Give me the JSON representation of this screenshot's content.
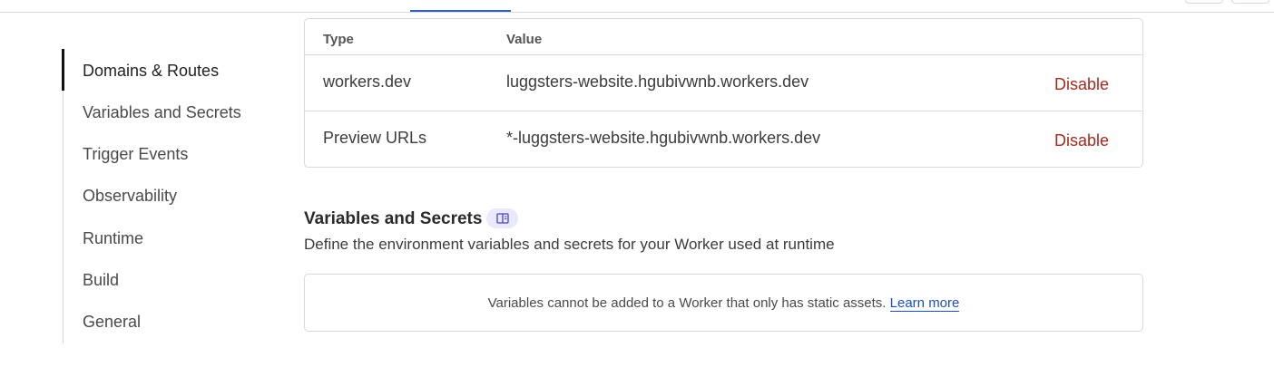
{
  "sidebar": {
    "items": [
      {
        "label": "Domains & Routes",
        "active": true
      },
      {
        "label": "Variables and Secrets"
      },
      {
        "label": "Trigger Events"
      },
      {
        "label": "Observability"
      },
      {
        "label": "Runtime"
      },
      {
        "label": "Build"
      },
      {
        "label": "General"
      }
    ]
  },
  "routes_table": {
    "headers": {
      "type": "Type",
      "value": "Value"
    },
    "rows": [
      {
        "type": "workers.dev",
        "value": "luggsters-website.hgubivwnb.workers.dev",
        "action": "Disable"
      },
      {
        "type": "Preview URLs",
        "value": "*-luggsters-website.hgubivwnb.workers.dev",
        "action": "Disable"
      }
    ]
  },
  "variables_section": {
    "title": "Variables and Secrets",
    "badge_icon": "book-icon",
    "description": "Define the environment variables and secrets for your Worker used at runtime",
    "notice": "Variables cannot be added to a Worker that only has static assets.",
    "learn_more": "Learn more"
  },
  "colors": {
    "accent": "#2c5dc8",
    "danger": "#a52a1e",
    "link": "#1d4fb8",
    "badge_bg": "#eae8fb"
  }
}
